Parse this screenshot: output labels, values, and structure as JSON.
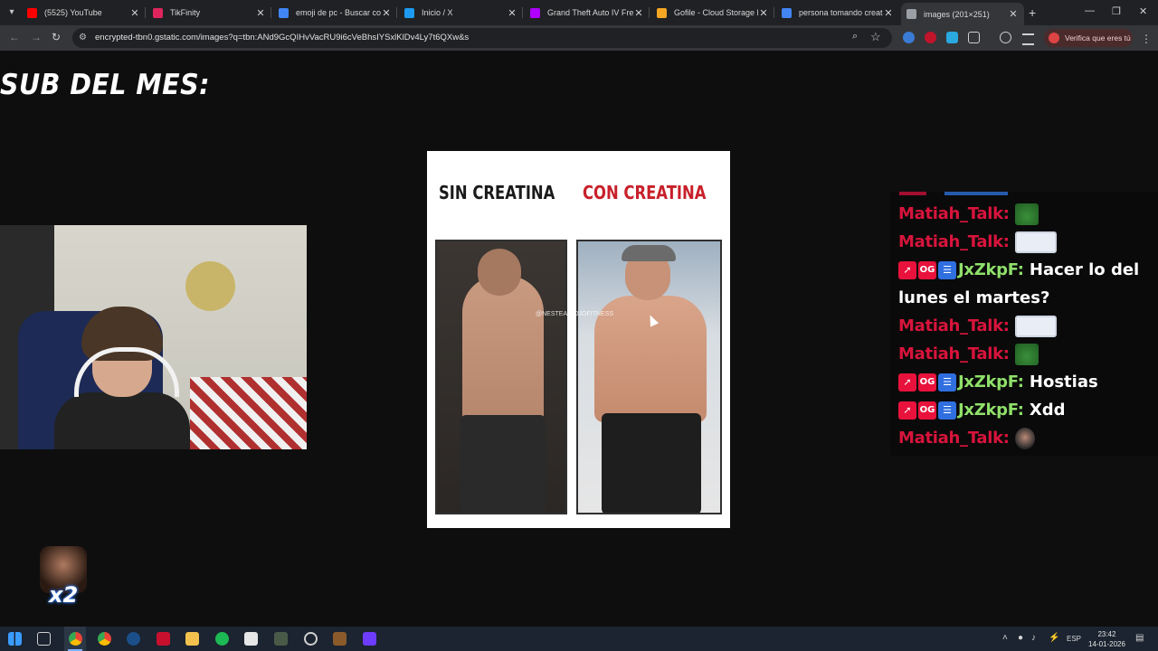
{
  "browser": {
    "tabs": [
      {
        "title": "(5525) YouTube",
        "favicon_color": "#ff0000",
        "active": false
      },
      {
        "title": "TikFinity",
        "favicon_color": "#e0245e",
        "active": false
      },
      {
        "title": "emoji de pc - Buscar con",
        "favicon_color": "#4285f4",
        "active": false
      },
      {
        "title": "Inicio / X",
        "favicon_color": "#1d9bf0",
        "active": false
      },
      {
        "title": "Grand Theft Auto IV Free",
        "favicon_color": "#b000ff",
        "active": false
      },
      {
        "title": "Gofile - Cloud Storage M",
        "favicon_color": "#f5a623",
        "active": false
      },
      {
        "title": "persona tomando creatin",
        "favicon_color": "#4285f4",
        "active": false
      },
      {
        "title": "images (201×251)",
        "favicon_color": "#9aa0a6",
        "active": true
      }
    ],
    "url": "encrypted-tbn0.gstatic.com/images?q=tbn:ANd9GcQIHvVacRU9i6cVeBhsIYSxlKlDv4Ly7t6QXw&s",
    "profile_label": "Verifica que eres tú",
    "window_controls": [
      "—",
      "❐",
      "✕"
    ]
  },
  "overlay": {
    "sub_title": "SUB DEL MES:",
    "compare": {
      "left_label": "SIN CREATINA",
      "right_label": "CON CREATINA",
      "watermark": "@NESTEA.ROJOFITNESS",
      "colors": {
        "left_label": "#1a1a1a",
        "right_label": "#c8202a"
      }
    },
    "badge_multiplier": "x2"
  },
  "chat": {
    "messages": [
      {
        "user": "Matiah_Talk:",
        "user_color": "#d8143c",
        "badges": [],
        "text": "",
        "emote": "frog"
      },
      {
        "user": "Matiah_Talk:",
        "user_color": "#d8143c",
        "badges": [],
        "text": "",
        "emote": "guy"
      },
      {
        "user": "JxZkpF:",
        "user_color": "#8fe06a",
        "badges": [
          "rocket",
          "OG",
          "list"
        ],
        "text": "Hacer lo del",
        "emote": ""
      },
      {
        "user": "",
        "user_color": "",
        "badges": [],
        "text": "lunes el martes?",
        "emote": ""
      },
      {
        "user": "Matiah_Talk:",
        "user_color": "#d8143c",
        "badges": [],
        "text": "",
        "emote": "guy"
      },
      {
        "user": "Matiah_Talk:",
        "user_color": "#d8143c",
        "badges": [],
        "text": "",
        "emote": "frog"
      },
      {
        "user": "JxZkpF:",
        "user_color": "#8fe06a",
        "badges": [
          "rocket",
          "OG",
          "list"
        ],
        "text": "Hostias",
        "emote": ""
      },
      {
        "user": "JxZkpF:",
        "user_color": "#8fe06a",
        "badges": [
          "rocket",
          "OG",
          "list"
        ],
        "text": "Xdd",
        "emote": ""
      },
      {
        "user": "Matiah_Talk:",
        "user_color": "#d8143c",
        "badges": [],
        "text": "",
        "emote": "face"
      }
    ],
    "og_label": "OG"
  },
  "taskbar": {
    "language": "ESP",
    "time": "23:42",
    "date": "14-01-2026"
  }
}
